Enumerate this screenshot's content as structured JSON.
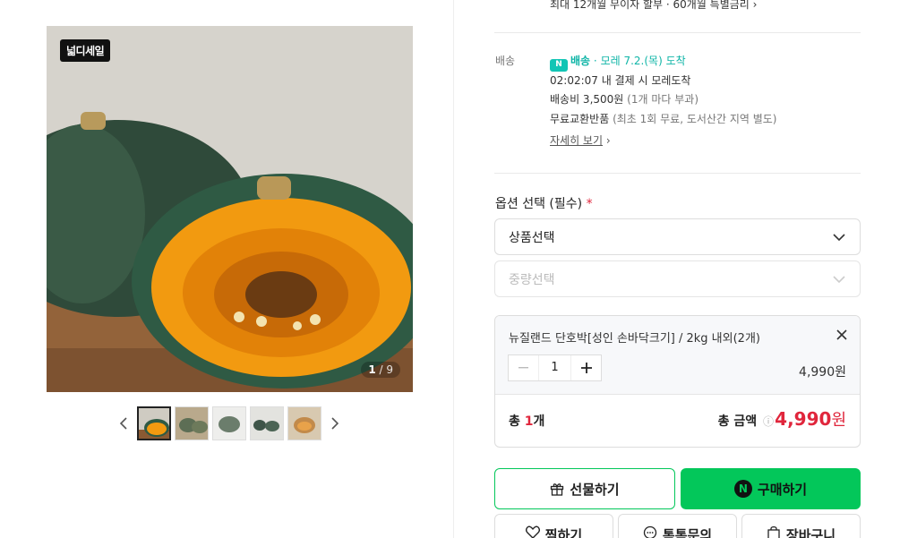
{
  "top_partial_text": "최대 12개월 무이자 할부 · 60개월 특별금리",
  "gallery": {
    "logo_text": "넓디세일",
    "counter_current": "1",
    "counter_total": "/ 9",
    "thumbnail_count": 5
  },
  "shipping": {
    "label": "배송",
    "badge": "N",
    "type": "배송",
    "eta": "모레 7.2.(목) 도착",
    "timer_line": "02:02:07  내 결제 시 모레도착",
    "fee_main": "배송비 3,500원",
    "fee_note": "(1개 마다 부과)",
    "exchange_main": "무료교환반품",
    "exchange_note": "(최초 1회 무료, 도서산간 지역 별도)",
    "detail_link": "자세히 보기"
  },
  "options": {
    "title": "옵션 선택 (필수)",
    "required_mark": "*",
    "select1": "상품선택",
    "select2": "중량선택"
  },
  "selected_item": {
    "name": "뉴질랜드 단호박[성인 손바닥크기] / 2kg 내외(2개)",
    "quantity": "1",
    "price": "4,990원"
  },
  "total": {
    "count_prefix": "총 ",
    "count_value": "1",
    "count_suffix": "개",
    "amount_label": "총 금액",
    "info_icon": "ⓘ",
    "amount": "4,990",
    "won": "원"
  },
  "buttons": {
    "gift": "선물하기",
    "buy": "구매하기",
    "wish": "찜하기",
    "talk": "톡톡문의",
    "cart": "장바구니"
  },
  "colors": {
    "naver_green": "#03c75a",
    "accent_red": "#e0263c",
    "teal": "#0fb5a7"
  }
}
